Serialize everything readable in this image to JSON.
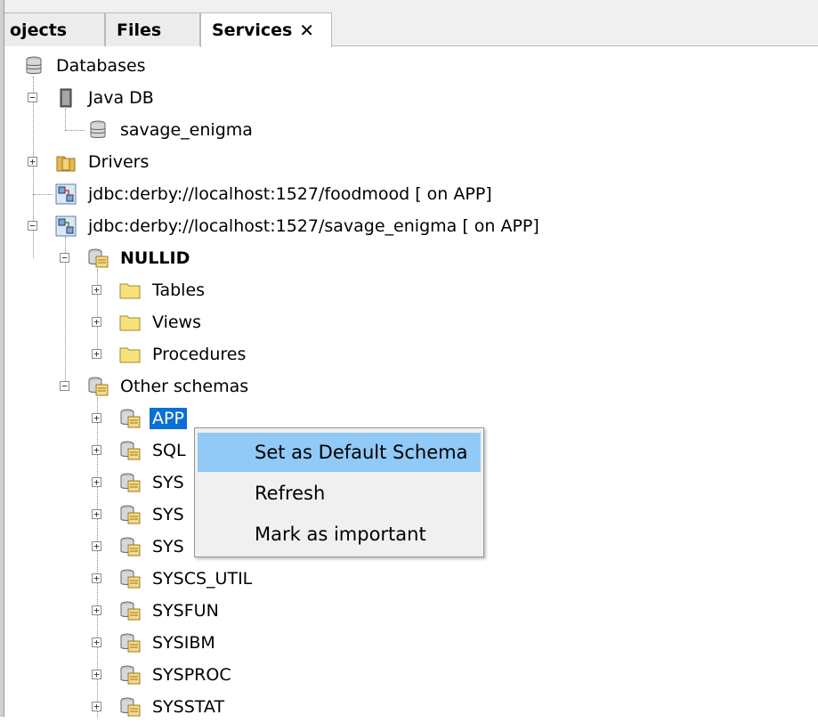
{
  "tabs": [
    {
      "label": "ojects",
      "active": false
    },
    {
      "label": "Files",
      "active": false
    },
    {
      "label": "Services",
      "active": true,
      "close": "✕"
    }
  ],
  "tree": {
    "databases": "Databases",
    "java_db": "Java DB",
    "savage_enigma_db": "savage_enigma",
    "drivers": "Drivers",
    "conn_foodmood": "jdbc:derby://localhost:1527/foodmood [ on APP]",
    "conn_savage": "jdbc:derby://localhost:1527/savage_enigma [ on APP]",
    "nullid": "NULLID",
    "tables": "Tables",
    "views": "Views",
    "procedures": "Procedures",
    "other_schemas": "Other schemas",
    "schemas": [
      "APP",
      "SQL",
      "SYS",
      "SYS",
      "SYS",
      "SYSCS_UTIL",
      "SYSFUN",
      "SYSIBM",
      "SYSPROC",
      "SYSSTAT"
    ]
  },
  "context_menu": {
    "items": [
      "Set as Default Schema",
      "Refresh",
      "Mark as important"
    ],
    "highlighted": "Set as Default Schema"
  },
  "colors": {
    "selection": "#0a6fd6",
    "menu_hover": "#91c9f7",
    "folder": "#f5e27a"
  }
}
